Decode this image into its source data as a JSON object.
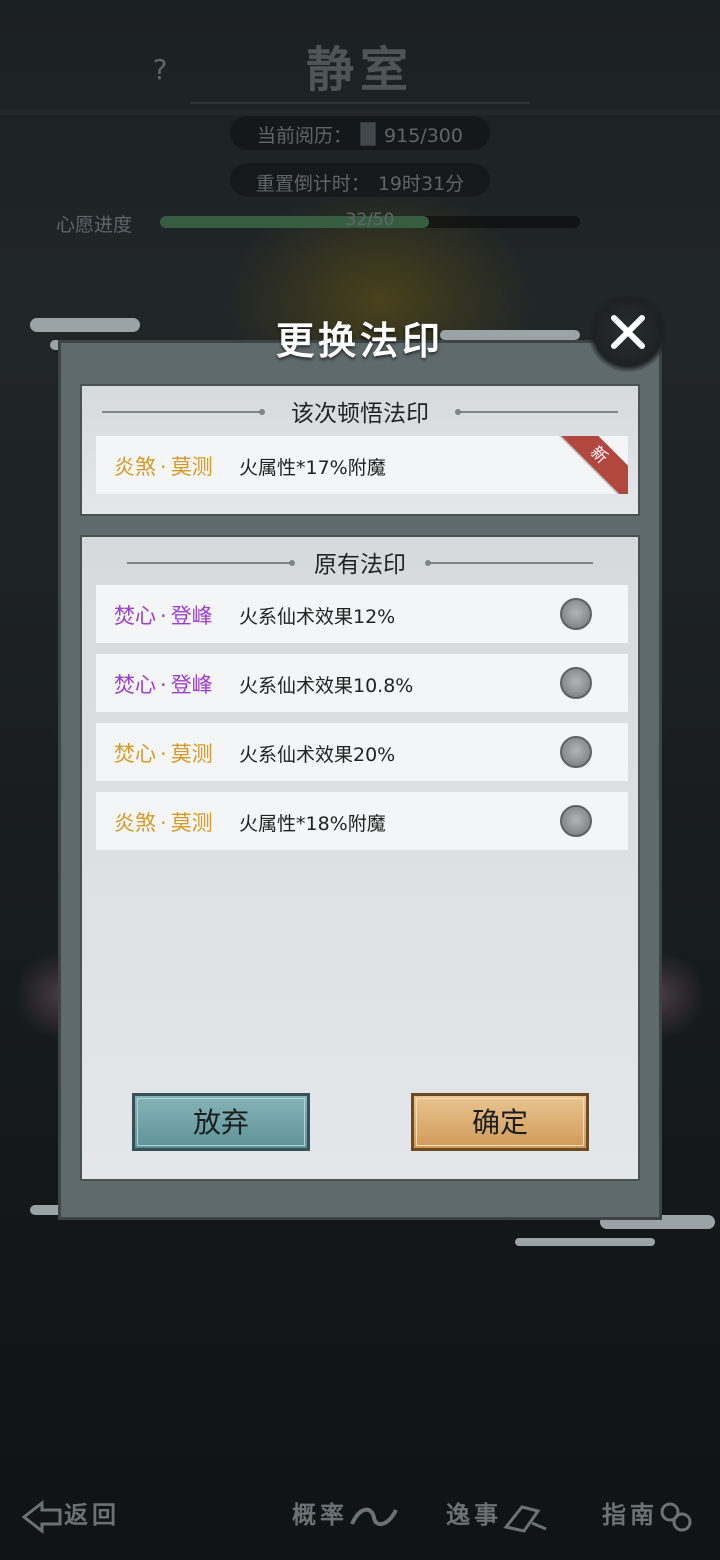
{
  "background": {
    "help_icon": "?",
    "room_title": "静室",
    "experience": {
      "label": "当前阅历：",
      "value": "915/300"
    },
    "reset_timer": {
      "label": "重置倒计时：",
      "value": "19时31分"
    },
    "wish_progress": {
      "label": "心愿进度",
      "text": "32/50",
      "current": 32,
      "max": 50
    }
  },
  "modal": {
    "title": "更换法印",
    "close_icon": "close-x-icon",
    "new_section": {
      "header": "该次顿悟法印",
      "item": {
        "prefix": "炎煞",
        "separator": "·",
        "suffix": "莫测",
        "effect": "火属性*17%附魔",
        "color": "#d39a28",
        "badge": "新"
      }
    },
    "old_section": {
      "header": "原有法印",
      "items": [
        {
          "prefix": "焚心",
          "separator": "·",
          "suffix": "登峰",
          "effect": "火系仙术效果12%",
          "color": "#9a3fce"
        },
        {
          "prefix": "焚心",
          "separator": "·",
          "suffix": "登峰",
          "effect": "火系仙术效果10.8%",
          "color": "#9a3fce"
        },
        {
          "prefix": "焚心",
          "separator": "·",
          "suffix": "莫测",
          "effect": "火系仙术效果20%",
          "color": "#d39a28"
        },
        {
          "prefix": "炎煞",
          "separator": "·",
          "suffix": "莫测",
          "effect": "火属性*18%附魔",
          "color": "#d39a28"
        }
      ]
    },
    "buttons": {
      "discard": "放弃",
      "confirm": "确定"
    }
  },
  "bottom_nav": {
    "back": "返回",
    "overview": "概率",
    "events": "逸事",
    "guide": "指南"
  }
}
